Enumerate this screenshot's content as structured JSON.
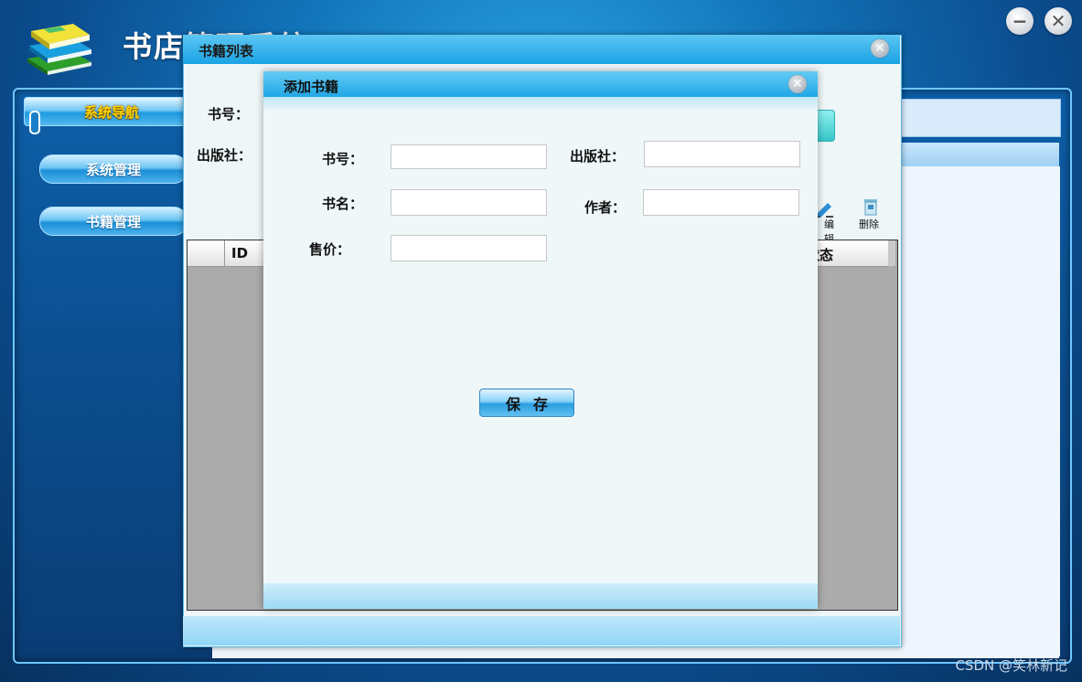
{
  "app": {
    "title": "书店管理系统",
    "minimize_glyph": "−",
    "close_glyph": "✕",
    "icons": {
      "logo": "books-logo-icon",
      "minimize": "minimize-icon",
      "close": "close-icon"
    }
  },
  "sidebar": {
    "header": "系统导航",
    "items": [
      {
        "label": "系统管理"
      },
      {
        "label": "书籍管理"
      }
    ]
  },
  "book_list_dialog": {
    "title": "书籍列表",
    "close_glyph": "✕",
    "search": {
      "book_no_label": "书号：",
      "publisher_label": "出版社："
    },
    "toolbar": {
      "edit_label": "编辑",
      "delete_label": "删除",
      "edit_icon": "edit-icon",
      "delete_icon": "trash-icon"
    },
    "grid": {
      "columns": [
        "ID",
        "状态"
      ]
    }
  },
  "add_book_dialog": {
    "title": "添加书籍",
    "close_glyph": "✕",
    "fields": {
      "book_no": {
        "label": "书号：",
        "value": ""
      },
      "publisher": {
        "label": "出版社：",
        "value": ""
      },
      "book_name": {
        "label": "书名：",
        "value": ""
      },
      "author": {
        "label": "作者：",
        "value": ""
      },
      "price": {
        "label": "售价：",
        "value": ""
      }
    },
    "save_label": "保存"
  },
  "watermark": "CSDN @笑林新记",
  "colors": {
    "background": "#0b4d8f",
    "title_bar": "#1aa3e4",
    "dialog_body": "#eff7f9",
    "nav_header_text": "#ffd400"
  }
}
